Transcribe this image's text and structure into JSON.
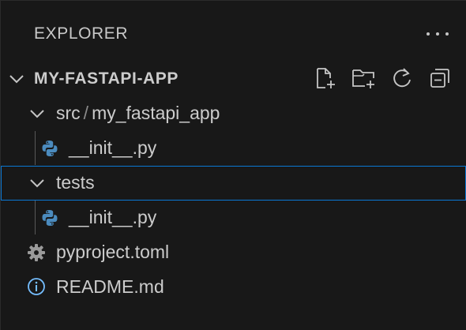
{
  "header": {
    "title": "EXPLORER",
    "more_icon": "ellipsis-icon"
  },
  "root": {
    "label": "MY-FASTAPI-APP",
    "toolbar": {
      "new_file_icon": "new-file-icon",
      "new_folder_icon": "new-folder-icon",
      "refresh_icon": "refresh-icon",
      "collapse_icon": "collapse-all-icon"
    }
  },
  "tree": {
    "src_folder": {
      "label": "src",
      "sep": "/",
      "sub": "my_fastapi_app"
    },
    "src_init": {
      "label": "__init__.py",
      "icon": "python-icon"
    },
    "tests_folder": {
      "label": "tests"
    },
    "tests_init": {
      "label": "__init__.py",
      "icon": "python-icon"
    },
    "pyproject": {
      "label": "pyproject.toml",
      "icon": "gear-icon"
    },
    "readme": {
      "label": "README.md",
      "icon": "info-icon"
    }
  },
  "colors": {
    "background": "#181818",
    "text": "#cccccc",
    "selection_border": "#0a78d4",
    "python_blue": "#4b8bbe",
    "python_yellow": "#d4b73a",
    "info_blue": "#75beff"
  }
}
